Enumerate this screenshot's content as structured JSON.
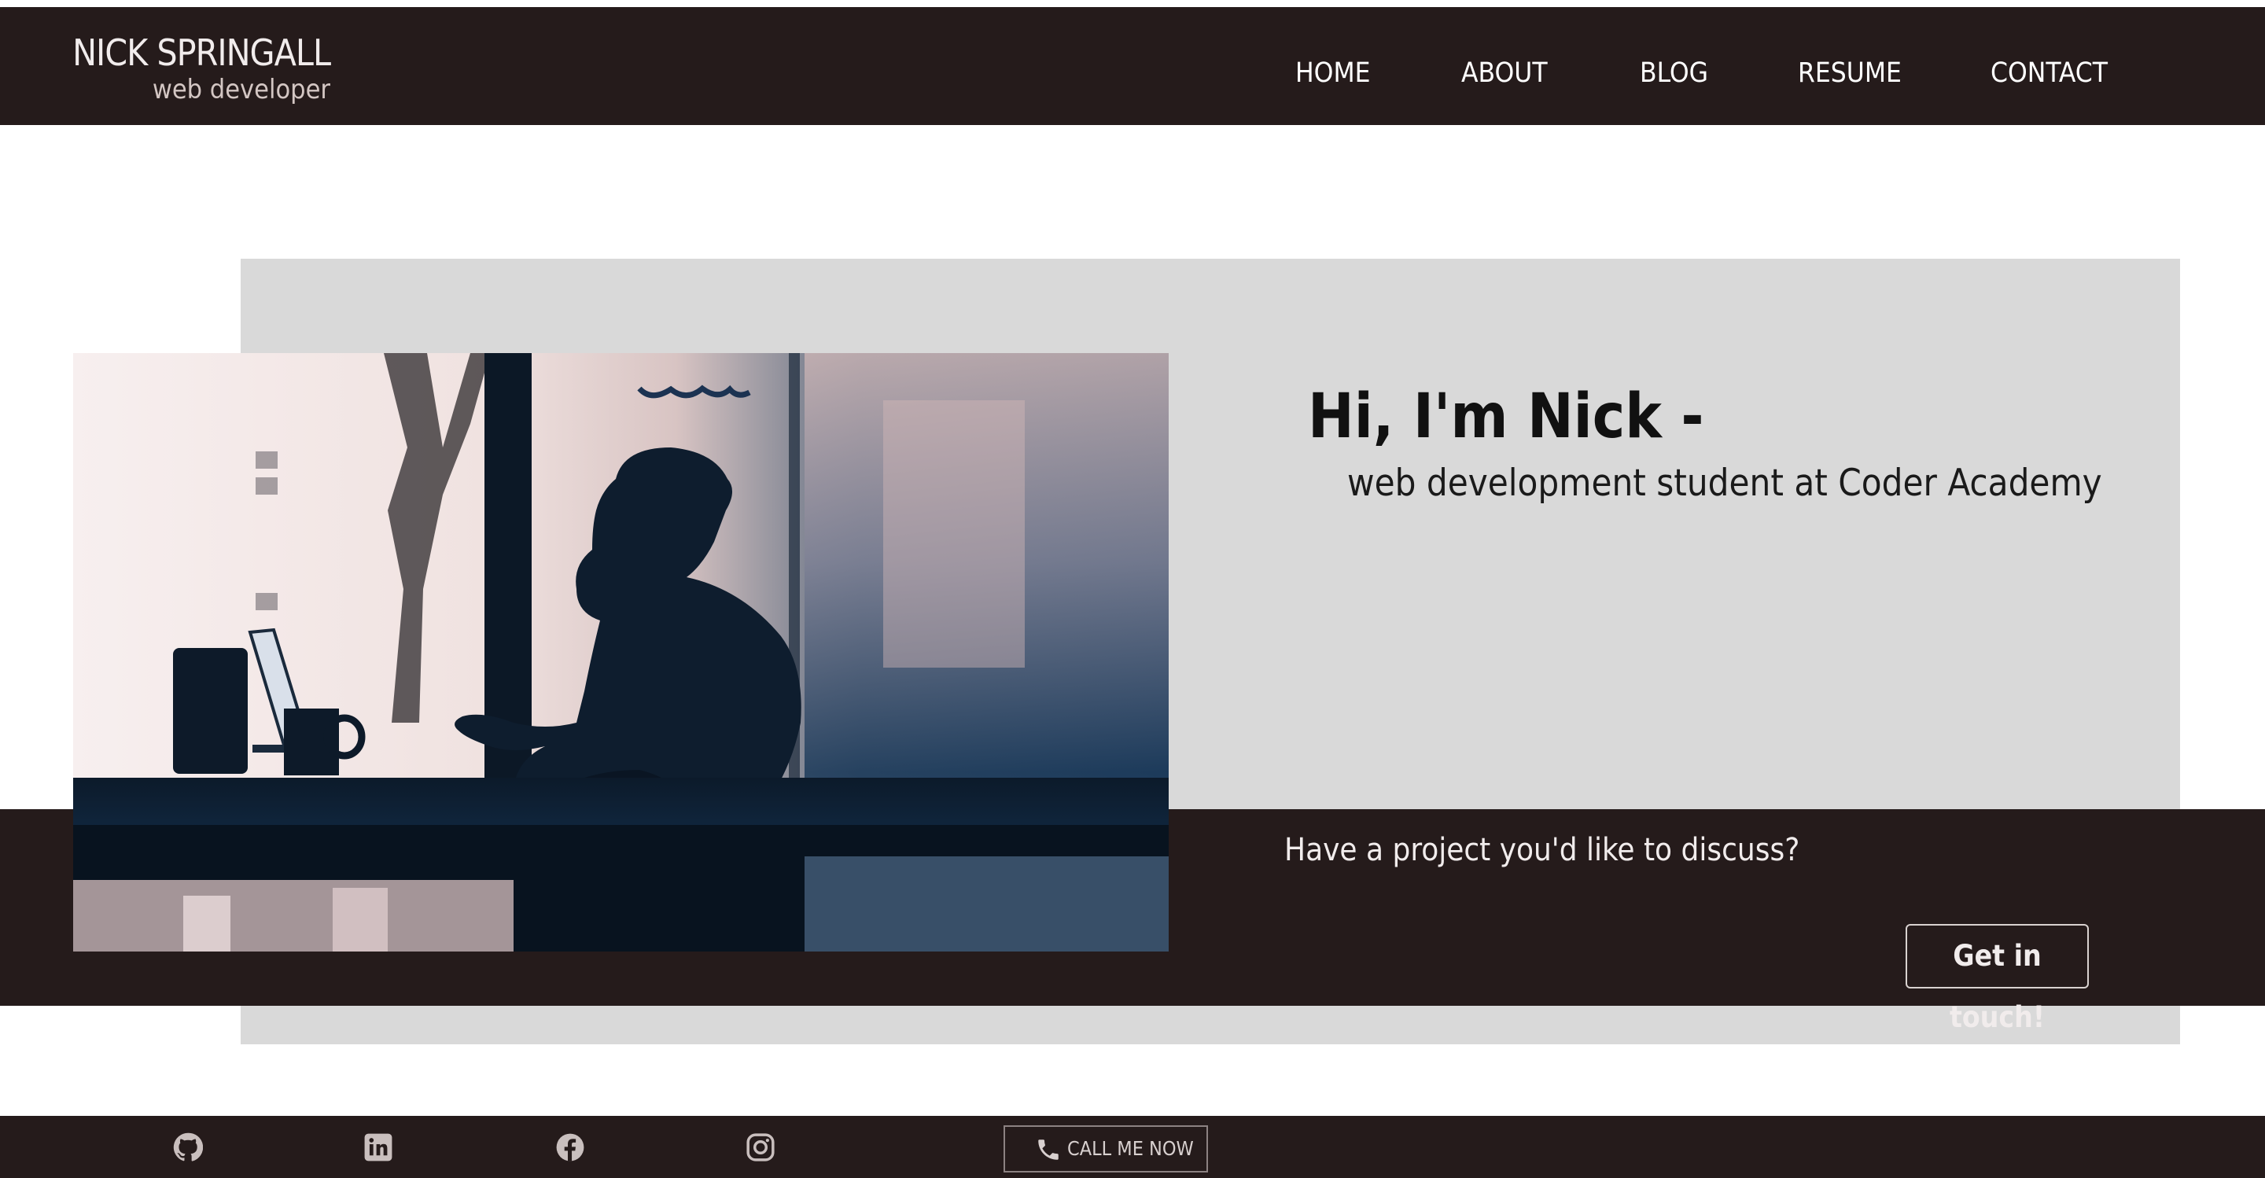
{
  "brand": {
    "name": "NICK SPRINGALL",
    "tagline": "web developer"
  },
  "nav": {
    "items": [
      {
        "label": "HOME"
      },
      {
        "label": "ABOUT"
      },
      {
        "label": "BLOG"
      },
      {
        "label": "RESUME"
      },
      {
        "label": "CONTACT"
      }
    ]
  },
  "hero": {
    "title": "Hi, I'm Nick -",
    "subtitle": "web development student at Coder Academy",
    "image_subject": "silhouette of a person at a cafe window with laptop and mug"
  },
  "cta": {
    "prompt": "Have a project you'd like to discuss?",
    "button_label": "Get in touch!"
  },
  "footer": {
    "social_icons": [
      "github-icon",
      "linkedin-icon",
      "facebook-icon",
      "instagram-icon"
    ],
    "call_button_label": "CALL ME NOW"
  },
  "colors": {
    "dark": "#251b1b",
    "hero_panel": "#d9d9d9",
    "text_light": "#f1ecec"
  }
}
